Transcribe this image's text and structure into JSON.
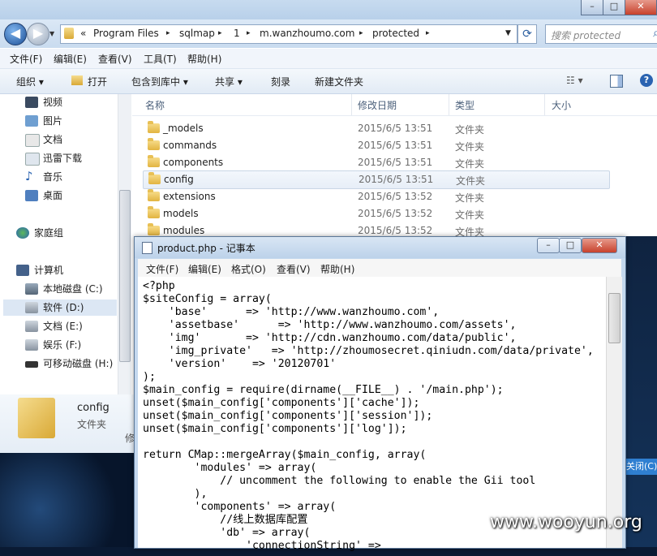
{
  "window_controls": {
    "minimize": "–",
    "maximize": "□",
    "close": "✕"
  },
  "address": {
    "crumbs": [
      "«",
      "Program Files",
      "sqlmap",
      "1",
      "m.wanzhoumo.com",
      "protected"
    ],
    "separator": "▸"
  },
  "search": {
    "placeholder": "搜索 protected"
  },
  "menubar": [
    "文件(F)",
    "编辑(E)",
    "查看(V)",
    "工具(T)",
    "帮助(H)"
  ],
  "toolbar": {
    "organize": "组织 ▾",
    "open": "打开",
    "include": "包含到库中 ▾",
    "share": "共享 ▾",
    "burn": "刻录",
    "new_folder": "新建文件夹"
  },
  "nav": {
    "favorites": [
      {
        "label": "视频",
        "icon": "video-icon"
      },
      {
        "label": "图片",
        "icon": "picture-icon"
      },
      {
        "label": "文档",
        "icon": "document-icon"
      },
      {
        "label": "迅雷下载",
        "icon": "download-icon"
      },
      {
        "label": "音乐",
        "icon": "music-icon"
      },
      {
        "label": "桌面",
        "icon": "desktop-icon"
      }
    ],
    "homegroup": "家庭组",
    "computer": "计算机",
    "drives": [
      {
        "label": "本地磁盘 (C:)"
      },
      {
        "label": "软件 (D:)",
        "selected": true
      },
      {
        "label": "文档 (E:)"
      },
      {
        "label": "娱乐 (F:)"
      },
      {
        "label": "可移动磁盘 (H:)"
      }
    ]
  },
  "columns": {
    "name": "名称",
    "modified": "修改日期",
    "type": "类型",
    "size": "大小"
  },
  "files": [
    {
      "name": "_models",
      "date": "2015/6/5 13:51",
      "type": "文件夹"
    },
    {
      "name": "commands",
      "date": "2015/6/5 13:51",
      "type": "文件夹"
    },
    {
      "name": "components",
      "date": "2015/6/5 13:51",
      "type": "文件夹"
    },
    {
      "name": "config",
      "date": "2015/6/5 13:51",
      "type": "文件夹",
      "selected": true
    },
    {
      "name": "extensions",
      "date": "2015/6/5 13:52",
      "type": "文件夹"
    },
    {
      "name": "models",
      "date": "2015/6/5 13:52",
      "type": "文件夹"
    },
    {
      "name": "modules",
      "date": "2015/6/5 13:52",
      "type": "文件夹"
    }
  ],
  "details": {
    "name": "config",
    "type": "文件夹",
    "partial": "修"
  },
  "notepad": {
    "title": "product.php - 记事本",
    "menu": [
      "文件(F)",
      "编辑(E)",
      "格式(O)",
      "查看(V)",
      "帮助(H)"
    ],
    "content": "<?php\n$siteConfig = array(\n    'base'      => 'http://www.wanzhoumo.com',\n    'assetbase'      => 'http://www.wanzhoumo.com/assets',\n    'img'       => 'http://cdn.wanzhoumo.com/data/public',\n    'img_private'   => 'http://zhoumosecret.qiniudn.com/data/private',\n    'version'    => '20120701'\n);\n$main_config = require(dirname(__FILE__) . '/main.php');\nunset($main_config['components']['cache']);\nunset($main_config['components']['session']);\nunset($main_config['components']['log']);\n\nreturn CMap::mergeArray($main_config, array(\n        'modules' => array(\n            // uncomment the following to enable the Gii tool\n        ),\n        'components' => array(\n            //线上数据库配置\n            'db' => array(\n                'connectionString' =>"
  },
  "taskbar_snippet": "关闭(C)",
  "watermark": "www.wooyun.org"
}
